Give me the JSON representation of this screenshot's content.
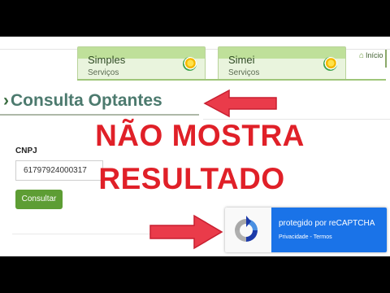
{
  "tabs": [
    {
      "title": "Simples",
      "subtitle": "Serviços"
    },
    {
      "title": "Simei",
      "subtitle": "Serviços"
    }
  ],
  "header": {
    "home_label": "Início"
  },
  "page": {
    "title": "Consulta Optantes"
  },
  "form": {
    "cnpj_label": "CNPJ",
    "cnpj_value": "61797924000317",
    "submit_label": "Consultar"
  },
  "overlay": {
    "line1": "NÃO MOSTRA",
    "line2": "RESULTADO",
    "color": "#e02028"
  },
  "recaptcha": {
    "title": "protegido por reCAPTCHA",
    "privacy": "Privacidade",
    "sep": " - ",
    "terms": "Termos",
    "accent": "#1a73e8"
  },
  "icons": [
    "simples-logo-icon",
    "simei-logo-icon",
    "home-icon",
    "chevron-right-icon",
    "recaptcha-logo-icon",
    "red-arrow-icon"
  ]
}
